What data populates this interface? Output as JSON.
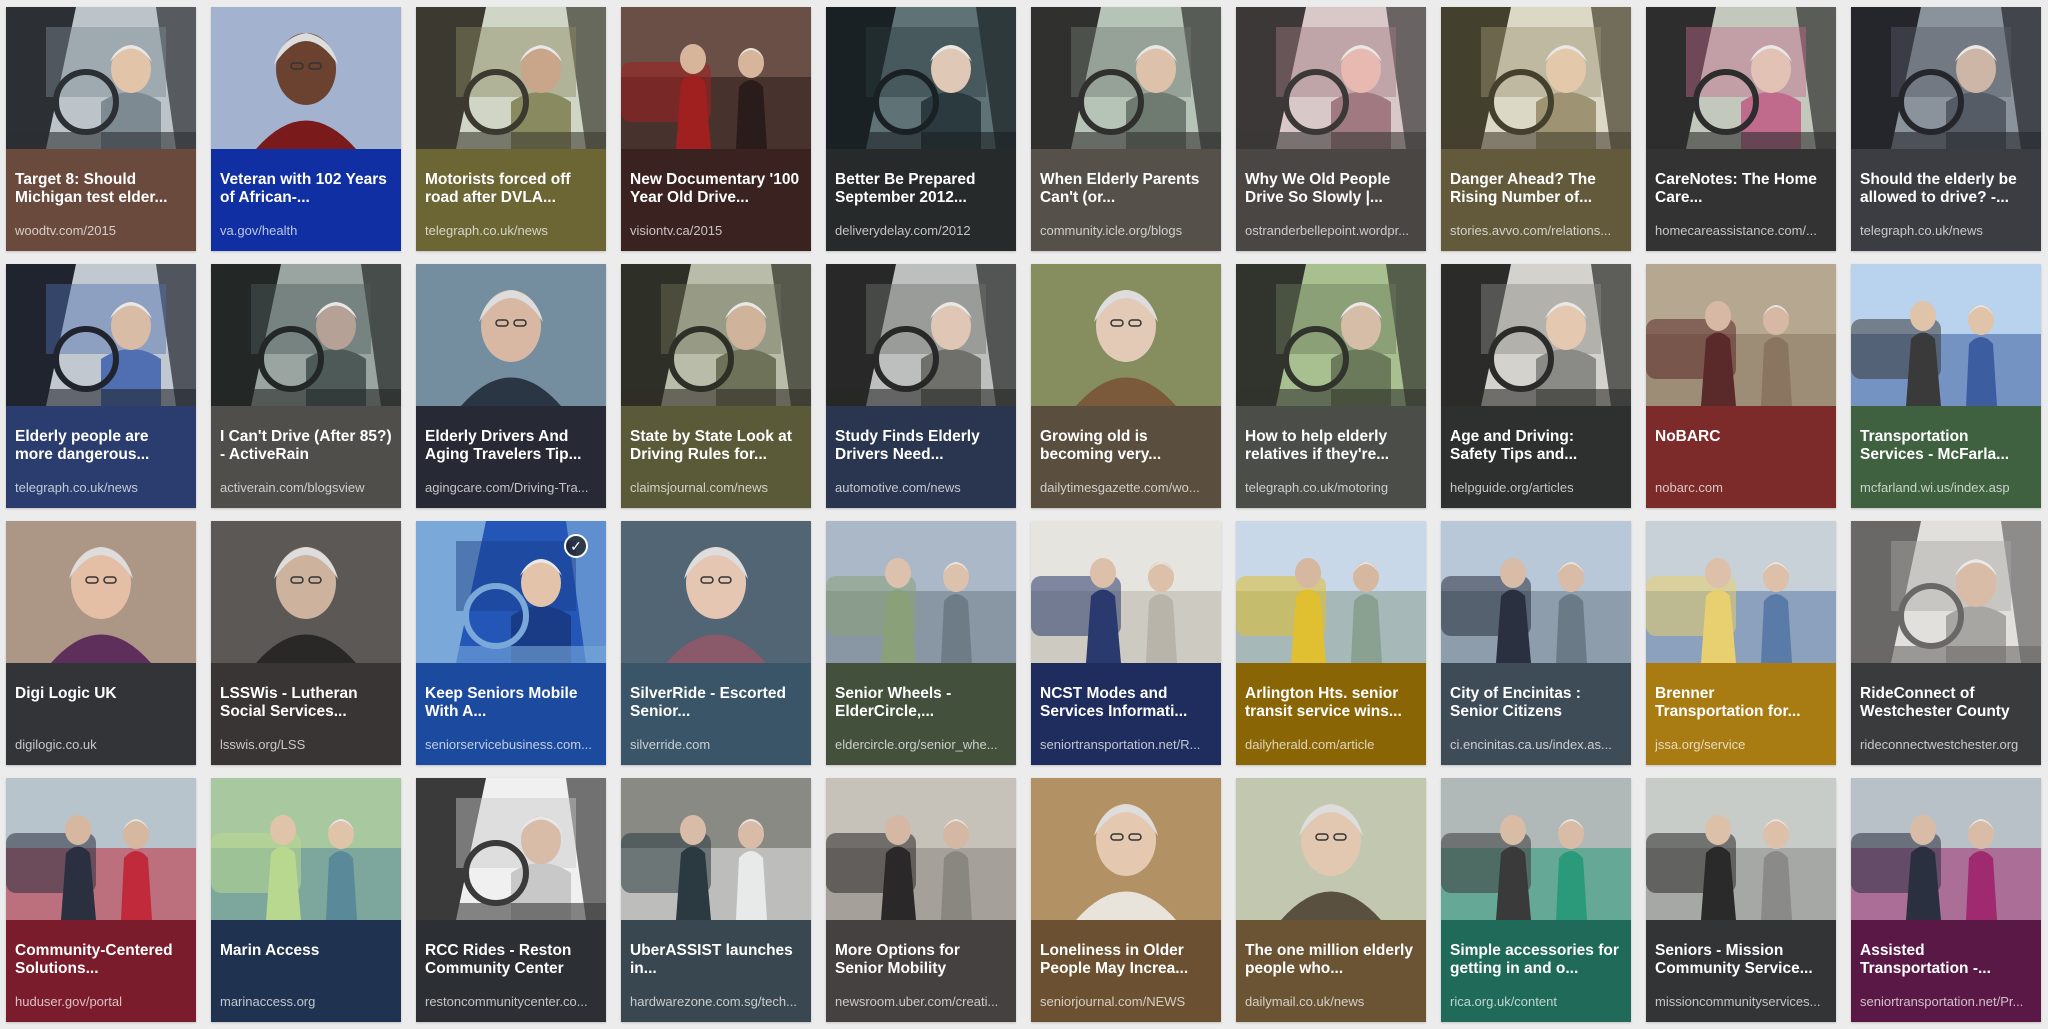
{
  "results": [
    {
      "title": "Target 8: Should Michigan test elder...",
      "source": "woodtv.com/2015",
      "color": "#6b4a3e",
      "scene": "car-driver",
      "palette": [
        "#bcc4c9",
        "#7d8a92",
        "#2c2f33",
        "#e2c4a8"
      ]
    },
    {
      "title": "Veteran with 102 Years of African-...",
      "source": "va.gov/health",
      "color": "#0f2fa3",
      "scene": "portrait",
      "palette": [
        "#dcdad8",
        "#3a6bc0",
        "#7a1a1a",
        "#6b4230"
      ]
    },
    {
      "title": "Motorists forced off road after DVLA...",
      "source": "telegraph.co.uk/news",
      "color": "#6b6634",
      "scene": "car-driver",
      "palette": [
        "#d0d6c6",
        "#8a8a60",
        "#3c3a30",
        "#c9a58a"
      ]
    },
    {
      "title": "New Documentary '100 Year Old Drive...",
      "source": "visiontv.ca/2015",
      "color": "#3a2220",
      "scene": "two-people",
      "palette": [
        "#6a4f46",
        "#2a1c1a",
        "#a02020",
        "#d7b59a"
      ]
    },
    {
      "title": "Better Be Prepared September 2012...",
      "source": "deliverydelay.com/2012",
      "color": "#262a2b",
      "scene": "car-driver",
      "palette": [
        "#5f7377",
        "#2b3a3e",
        "#1a2124",
        "#e0c8b6"
      ]
    },
    {
      "title": "When Elderly Parents Can't (or...",
      "source": "community.icle.org/blogs",
      "color": "#55504a",
      "scene": "car-driver",
      "palette": [
        "#b6c4b8",
        "#6f7a70",
        "#30312e",
        "#ddc1ab"
      ]
    },
    {
      "title": "Why We Old People Drive So Slowly |...",
      "source": "ostranderbellepoint.wordpr...",
      "color": "#4a4644",
      "scene": "car-driver",
      "palette": [
        "#d9c8c8",
        "#a07a80",
        "#3b3837",
        "#e7b9b0"
      ]
    },
    {
      "title": "Danger Ahead? The Rising Number of...",
      "source": "stories.avvo.com/relations...",
      "color": "#625a3b",
      "scene": "car-driver",
      "palette": [
        "#dcd8c6",
        "#9e9474",
        "#44402e",
        "#e3c8a9"
      ]
    },
    {
      "title": "CareNotes: The Home Care...",
      "source": "homecareassistance.com/...",
      "color": "#333333",
      "scene": "car-driver",
      "palette": [
        "#c3c8bc",
        "#c06a8c",
        "#2d2d2d",
        "#e2c2b4"
      ]
    },
    {
      "title": "Should the elderly be allowed to drive? -...",
      "source": "telegraph.co.uk/news",
      "color": "#3c3d42",
      "scene": "car-driver",
      "palette": [
        "#8a929c",
        "#565c66",
        "#24262b",
        "#cdb6a6"
      ]
    },
    {
      "title": "Elderly people are more dangerous...",
      "source": "telegraph.co.uk/news",
      "color": "#2a3d6e",
      "scene": "car-driver",
      "palette": [
        "#c2c8d0",
        "#4f6fb2",
        "#20242e",
        "#d9bca6"
      ]
    },
    {
      "title": "I Can't Drive (After 85?) - ActiveRain",
      "source": "activerain.com/blogsview",
      "color": "#504e4a",
      "scene": "car-driver",
      "palette": [
        "#9aa4a0",
        "#4d5a58",
        "#232827",
        "#b6a196"
      ]
    },
    {
      "title": "Elderly Drivers And Aging Travelers Tip...",
      "source": "agingcare.com/Driving-Tra...",
      "color": "#272a34",
      "scene": "portrait",
      "palette": [
        "#8aa0b0",
        "#4a6a82",
        "#2a3644",
        "#d8b8a2"
      ]
    },
    {
      "title": "State by State Look at Driving Rules for...",
      "source": "claimsjournal.com/news",
      "color": "#5a5a38",
      "scene": "car-driver",
      "palette": [
        "#b8bca8",
        "#6e7258",
        "#2e2f26",
        "#cfb39a"
      ]
    },
    {
      "title": "Study Finds Elderly Drivers Need...",
      "source": "automotive.com/news",
      "color": "#2a3650",
      "scene": "car-driver",
      "palette": [
        "#bdbfbf",
        "#6f706c",
        "#272827",
        "#e0c7b5"
      ]
    },
    {
      "title": "Growing old is becoming very...",
      "source": "dailytimesgazette.com/wo...",
      "color": "#5a4e3e",
      "scene": "portrait",
      "palette": [
        "#9aa070",
        "#606a3e",
        "#7a5a3a",
        "#e2cab6"
      ]
    },
    {
      "title": "How to help elderly relatives if they're...",
      "source": "telegraph.co.uk/motoring",
      "color": "#4b4e48",
      "scene": "car-driver",
      "palette": [
        "#a8c090",
        "#6b7a5a",
        "#30342c",
        "#d6bda8"
      ]
    },
    {
      "title": "Age and Driving: Safety Tips and...",
      "source": "helpguide.org/articles",
      "color": "#2e2f2f",
      "scene": "car-driver",
      "palette": [
        "#d4d2cc",
        "#8a8a86",
        "#2b2b2a",
        "#e4c8b0"
      ]
    },
    {
      "title": "NoBARC",
      "source": "nobarc.com",
      "color": "#7c2b2a",
      "scene": "two-people",
      "palette": [
        "#b6a890",
        "#8a7660",
        "#5a2a2a",
        "#d6b8a4"
      ]
    },
    {
      "title": "Transportation Services - McFarla...",
      "source": "mcfarland.wi.us/index.asp",
      "color": "#3f6140",
      "scene": "two-people",
      "palette": [
        "#b9d2ee",
        "#3c5ea0",
        "#3a3a3a",
        "#e0c4aa"
      ]
    },
    {
      "title": "Digi Logic UK",
      "source": "digilogic.co.uk",
      "color": "#333438",
      "scene": "portrait",
      "palette": [
        "#bfae9e",
        "#8a6a58",
        "#5e2f5a",
        "#e4bfa6"
      ]
    },
    {
      "title": "LSSWis - Lutheran Social Services...",
      "source": "lsswis.org/LSS",
      "color": "#3a3535",
      "scene": "portrait",
      "palette": [
        "#6a6866",
        "#3e3c3a",
        "#2a2827",
        "#cdb39e"
      ]
    },
    {
      "title": "Keep Seniors Mobile With A...",
      "source": "seniorservicebusiness.com...",
      "color": "#1c4a9e",
      "scene": "car-driver",
      "palette": [
        "#2456b8",
        "#1a3c86",
        "#7aa8d8",
        "#e3c4aa"
      ],
      "selected": true
    },
    {
      "title": "SilverRide - Escorted Senior...",
      "source": "silverride.com",
      "color": "#3a5468",
      "scene": "portrait",
      "palette": [
        "#5e7484",
        "#3a4a56",
        "#8a5a6a",
        "#e4c6b2"
      ]
    },
    {
      "title": "Senior Wheels - ElderCircle,...",
      "source": "eldercircle.org/senior_whe...",
      "color": "#43503c",
      "scene": "two-people",
      "palette": [
        "#aab8c8",
        "#6e7c88",
        "#8aa078",
        "#dcc2ac"
      ]
    },
    {
      "title": "NCST Modes and Services Informati...",
      "source": "seniortransportation.net/R...",
      "color": "#1f2c5e",
      "scene": "two-people",
      "palette": [
        "#e6e4de",
        "#b8b4aa",
        "#2a3a6e",
        "#dcc0aa"
      ]
    },
    {
      "title": "Arlington Hts. senior transit service wins...",
      "source": "dailyherald.com/article",
      "color": "#8a6506",
      "scene": "two-people",
      "palette": [
        "#c8d8e8",
        "#8aa090",
        "#e0c030",
        "#d6b8a0"
      ]
    },
    {
      "title": "City of Encinitas : Senior Citizens",
      "source": "ci.encinitas.ca.us/index.as...",
      "color": "#3e4c58",
      "scene": "two-people",
      "palette": [
        "#b8c8d8",
        "#6a7a86",
        "#2a3040",
        "#d8bca8"
      ]
    },
    {
      "title": "Brenner Transportation for...",
      "source": "jssa.org/service",
      "color": "#a87c12",
      "scene": "two-people",
      "palette": [
        "#c8d0d8",
        "#5a7aa8",
        "#e8d070",
        "#dcc0aa"
      ]
    },
    {
      "title": "RideConnect of Westchester County",
      "source": "rideconnectwestchester.org",
      "color": "#3a3b3d",
      "scene": "car-driver",
      "palette": [
        "#e2e0dc",
        "#a8a6a2",
        "#6a6866",
        "#d8bca8"
      ]
    },
    {
      "title": "Community-Centered Solutions...",
      "source": "huduser.gov/portal",
      "color": "#7a1c2c",
      "scene": "two-people",
      "palette": [
        "#b8c4cc",
        "#c02a3a",
        "#2a3040",
        "#d6b8a0"
      ]
    },
    {
      "title": "Marin Access",
      "source": "marinaccess.org",
      "color": "#1f3250",
      "scene": "two-people",
      "palette": [
        "#a8c8a0",
        "#5a8a9a",
        "#b8d890",
        "#e0c4aa"
      ]
    },
    {
      "title": "RCC Rides - Reston Community Center",
      "source": "restoncommunitycenter.co...",
      "color": "#2c2f33",
      "scene": "car-driver",
      "palette": [
        "#f0f0f0",
        "#c8c8c8",
        "#3a3a3a",
        "#d8bca8"
      ]
    },
    {
      "title": "UberASSIST launches in...",
      "source": "hardwarezone.com.sg/tech...",
      "color": "#394850",
      "scene": "two-people",
      "palette": [
        "#8a8a84",
        "#e8eaea",
        "#2a3a40",
        "#d8bca8"
      ]
    },
    {
      "title": "More Options for Senior Mobility",
      "source": "newsroom.uber.com/creati...",
      "color": "#444140",
      "scene": "two-people",
      "palette": [
        "#c6c2ba",
        "#8a8680",
        "#2a2828",
        "#d4b8a4"
      ]
    },
    {
      "title": "Loneliness in Older People May Increa...",
      "source": "seniorjournal.com/NEWS",
      "color": "#6b5031",
      "scene": "portrait",
      "palette": [
        "#c8a878",
        "#8a6a40",
        "#e8e4dc",
        "#e4c8b0"
      ]
    },
    {
      "title": "The one million elderly people who...",
      "source": "dailymail.co.uk/news",
      "color": "#6a5434",
      "scene": "portrait",
      "palette": [
        "#d8dcc8",
        "#9aa080",
        "#5a5040",
        "#e2c8b0"
      ]
    },
    {
      "title": "Simple accessories for getting in and o...",
      "source": "rica.org.uk/content",
      "color": "#1f6a58",
      "scene": "two-people",
      "palette": [
        "#b0b8b8",
        "#2a9a7a",
        "#3a3a3a",
        "#d8bca6"
      ]
    },
    {
      "title": "Seniors - Mission Community Service...",
      "source": "missioncommunityservices...",
      "color": "#333436",
      "scene": "two-people",
      "palette": [
        "#c8ccc8",
        "#8a8a88",
        "#2a2a2a",
        "#dcc0aa"
      ]
    },
    {
      "title": "Assisted Transportation -...",
      "source": "seniortransportation.net/Pr...",
      "color": "#5a1846",
      "scene": "two-people",
      "palette": [
        "#b8c0c8",
        "#a02a70",
        "#2a3040",
        "#d8bca8"
      ]
    }
  ]
}
